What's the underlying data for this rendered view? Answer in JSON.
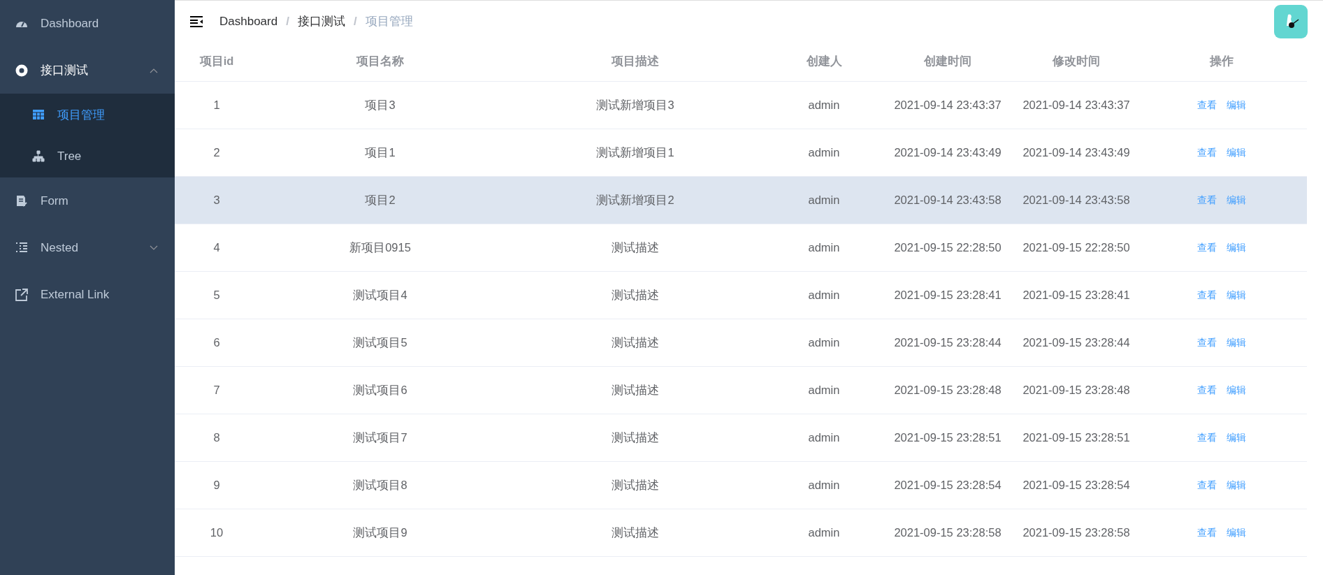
{
  "sidebar": {
    "items": [
      {
        "kind": "item",
        "label": "Dashboard",
        "selected": false
      },
      {
        "kind": "submenu",
        "label": "接口测试",
        "expanded": true,
        "children": [
          {
            "kind": "item",
            "label": "项目管理",
            "selected": true
          },
          {
            "kind": "item",
            "label": "Tree",
            "selected": false
          }
        ]
      },
      {
        "kind": "item",
        "label": "Form",
        "selected": false
      },
      {
        "kind": "submenu",
        "label": "Nested",
        "expanded": false
      },
      {
        "kind": "item",
        "label": "External Link",
        "selected": false
      }
    ]
  },
  "breadcrumb": [
    {
      "label": "Dashboard"
    },
    {
      "label": "接口测试"
    },
    {
      "label": "项目管理"
    }
  ],
  "breadcrumb_separator": "/",
  "table": {
    "columns": [
      "项目id",
      "项目名称",
      "项目描述",
      "创建人",
      "创建时间",
      "修改时间",
      "操作"
    ],
    "rows": [
      {
        "id": "1",
        "name": "项目3",
        "description": "测试新增项目3",
        "creator": "admin",
        "created": "2021-09-14 23:43:37",
        "modified": "2021-09-14 23:43:37",
        "actions": [
          "查看",
          "编辑"
        ],
        "hovered": false
      },
      {
        "id": "2",
        "name": "项目1",
        "description": "测试新增项目1",
        "creator": "admin",
        "created": "2021-09-14 23:43:49",
        "modified": "2021-09-14 23:43:49",
        "actions": [
          "查看",
          "编辑"
        ],
        "hovered": false
      },
      {
        "id": "3",
        "name": "项目2",
        "description": "测试新增项目2",
        "creator": "admin",
        "created": "2021-09-14 23:43:58",
        "modified": "2021-09-14 23:43:58",
        "actions": [
          "查看",
          "编辑"
        ],
        "hovered": true
      },
      {
        "id": "4",
        "name": "新项目0915",
        "description": "测试描述",
        "creator": "admin",
        "created": "2021-09-15 22:28:50",
        "modified": "2021-09-15 22:28:50",
        "actions": [
          "查看",
          "编辑"
        ],
        "hovered": false
      },
      {
        "id": "5",
        "name": "测试项目4",
        "description": "测试描述",
        "creator": "admin",
        "created": "2021-09-15 23:28:41",
        "modified": "2021-09-15 23:28:41",
        "actions": [
          "查看",
          "编辑"
        ],
        "hovered": false
      },
      {
        "id": "6",
        "name": "测试项目5",
        "description": "测试描述",
        "creator": "admin",
        "created": "2021-09-15 23:28:44",
        "modified": "2021-09-15 23:28:44",
        "actions": [
          "查看",
          "编辑"
        ],
        "hovered": false
      },
      {
        "id": "7",
        "name": "测试项目6",
        "description": "测试描述",
        "creator": "admin",
        "created": "2021-09-15 23:28:48",
        "modified": "2021-09-15 23:28:48",
        "actions": [
          "查看",
          "编辑"
        ],
        "hovered": false
      },
      {
        "id": "8",
        "name": "测试项目7",
        "description": "测试描述",
        "creator": "admin",
        "created": "2021-09-15 23:28:51",
        "modified": "2021-09-15 23:28:51",
        "actions": [
          "查看",
          "编辑"
        ],
        "hovered": false
      },
      {
        "id": "9",
        "name": "测试项目8",
        "description": "测试描述",
        "creator": "admin",
        "created": "2021-09-15 23:28:54",
        "modified": "2021-09-15 23:28:54",
        "actions": [
          "查看",
          "编辑"
        ],
        "hovered": false
      },
      {
        "id": "10",
        "name": "测试项目9",
        "description": "测试描述",
        "creator": "admin",
        "created": "2021-09-15 23:28:58",
        "modified": "2021-09-15 23:28:58",
        "actions": [
          "查看",
          "编辑"
        ],
        "hovered": false
      }
    ]
  }
}
